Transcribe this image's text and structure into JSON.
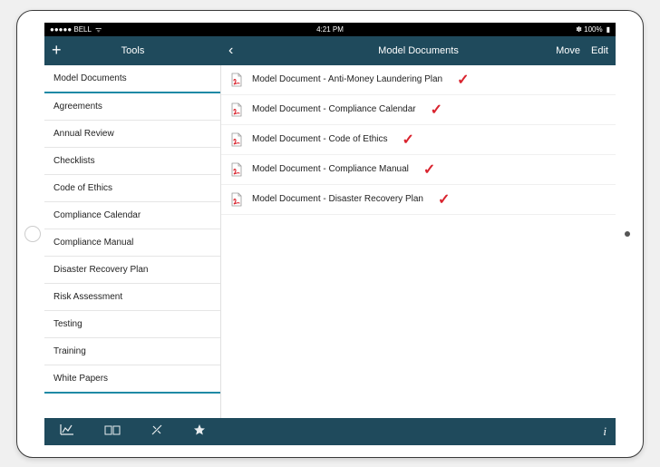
{
  "status": {
    "carrier": "●●●●● BELL",
    "wifi": "ᯤ",
    "time": "4:21 PM",
    "bluetooth": "✽ 100%",
    "battery": "▮"
  },
  "nav": {
    "left": {
      "add": "+",
      "title": "Tools"
    },
    "right": {
      "back": "‹",
      "title": "Model Documents",
      "move": "Move",
      "edit": "Edit"
    }
  },
  "sidebar": {
    "items": [
      {
        "label": "Model Documents",
        "selected": true
      },
      {
        "label": "Agreements",
        "selected": false
      },
      {
        "label": "Annual Review",
        "selected": false
      },
      {
        "label": "Checklists",
        "selected": false
      },
      {
        "label": "Code of Ethics",
        "selected": false
      },
      {
        "label": "Compliance Calendar",
        "selected": false
      },
      {
        "label": "Compliance Manual",
        "selected": false
      },
      {
        "label": "Disaster Recovery Plan",
        "selected": false
      },
      {
        "label": "Risk Assessment",
        "selected": false
      },
      {
        "label": "Testing",
        "selected": false
      },
      {
        "label": "Training",
        "selected": false
      },
      {
        "label": "White Papers",
        "selected": true
      }
    ]
  },
  "documents": [
    {
      "label": "Model Document - Anti-Money Laundering Plan",
      "checked": true
    },
    {
      "label": "Model Document - Compliance Calendar",
      "checked": true
    },
    {
      "label": "Model Document - Code of Ethics",
      "checked": true
    },
    {
      "label": "Model Document - Compliance Manual",
      "checked": true
    },
    {
      "label": "Model Document - Disaster Recovery Plan",
      "checked": true
    }
  ],
  "tabbar": {
    "icons": [
      "chart-icon",
      "cards-icon",
      "tools-icon",
      "star-icon"
    ],
    "info": "i"
  },
  "colors": {
    "navbar": "#1f4a5c",
    "accent": "#1f8aa5",
    "check": "#d9232e"
  }
}
